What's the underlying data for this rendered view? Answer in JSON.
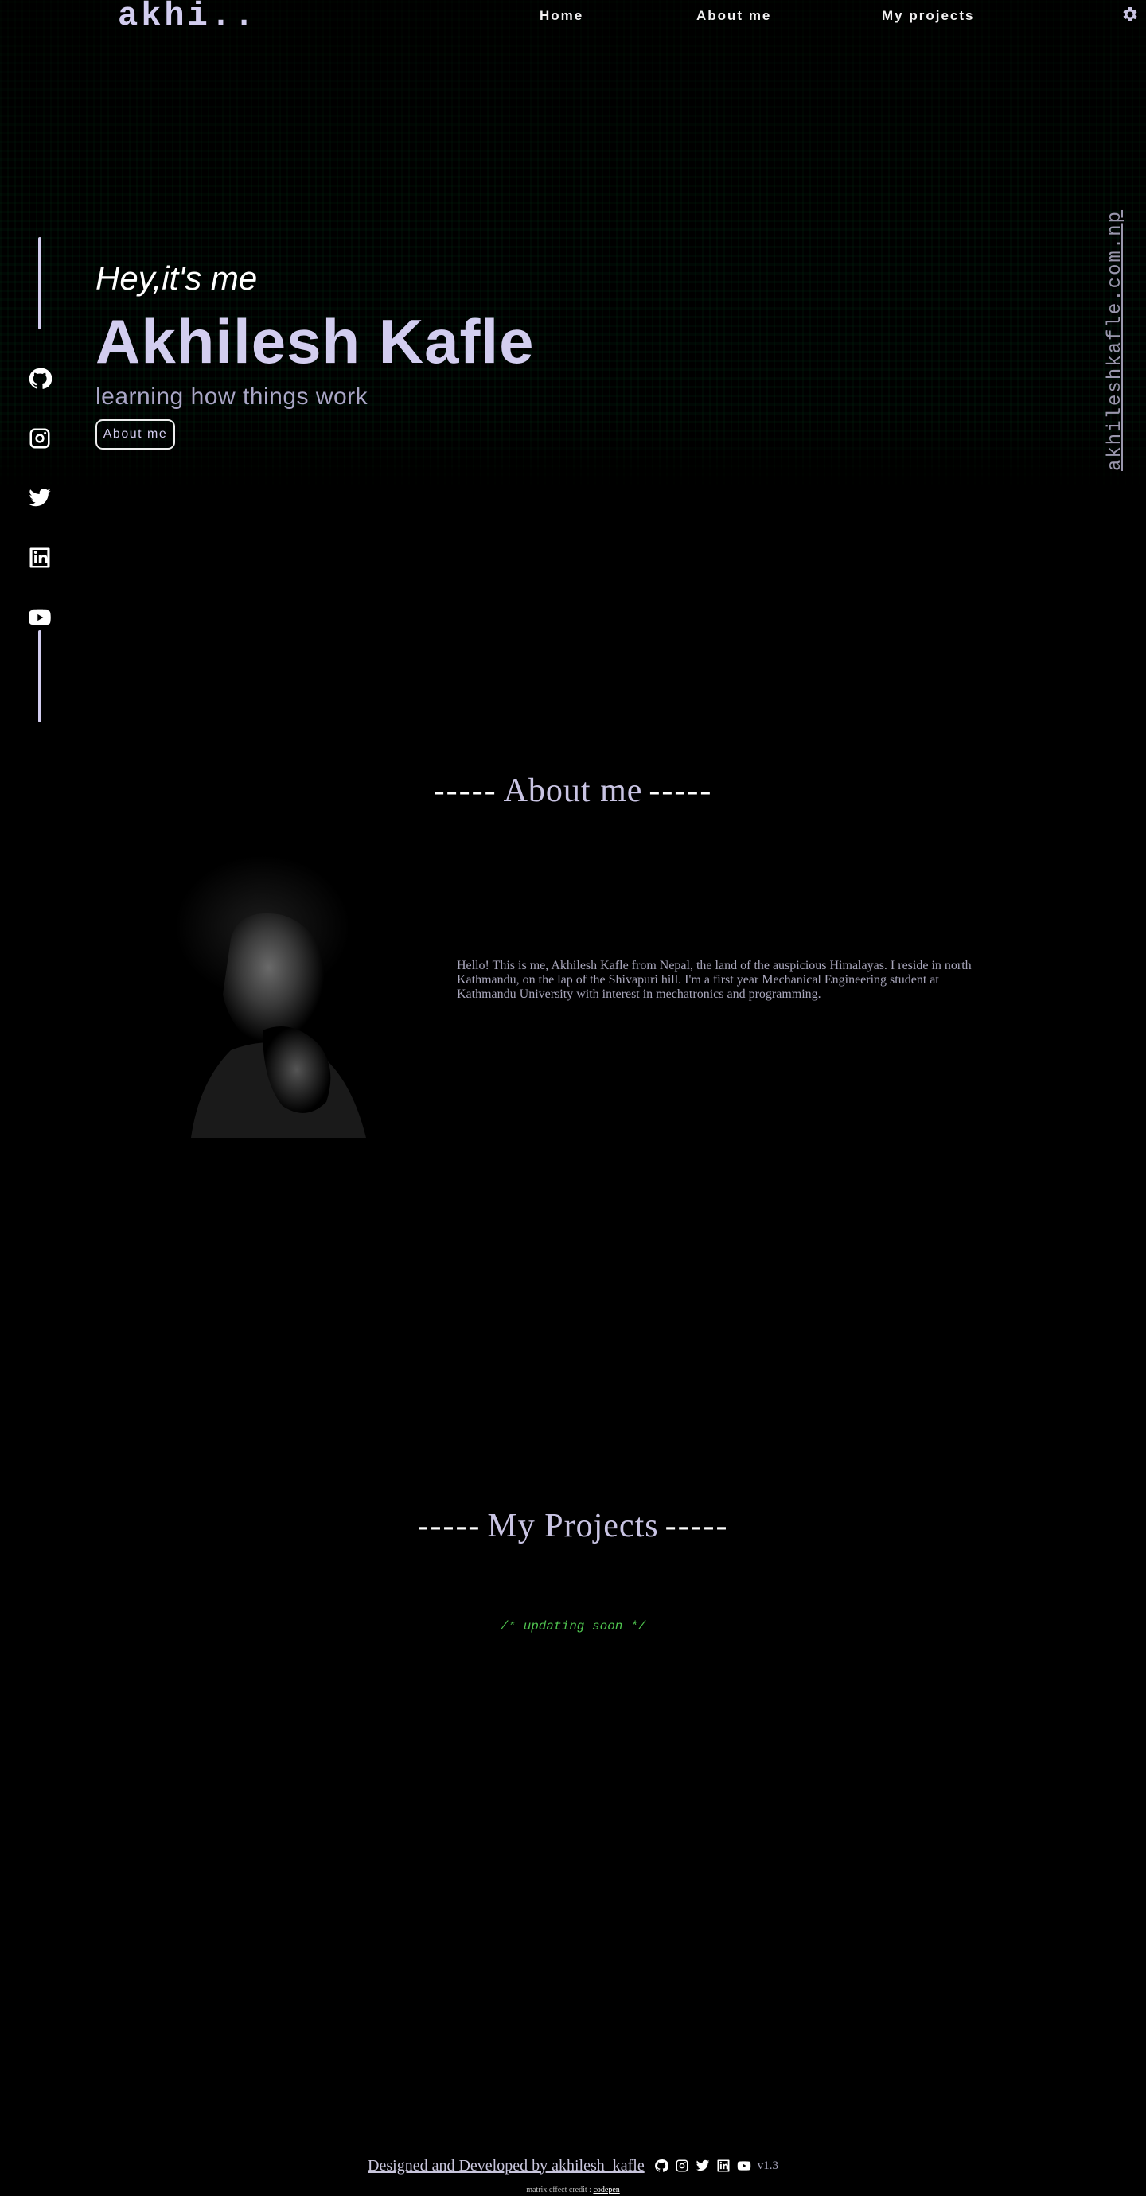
{
  "nav": {
    "logo": "akhi..",
    "links": [
      "Home",
      "About me",
      "My projects"
    ],
    "settings_icon": "gear-icon"
  },
  "social": [
    "github-icon",
    "instagram-icon",
    "twitter-icon",
    "linkedin-icon",
    "youtube-icon"
  ],
  "hero": {
    "greeting": "Hey,it's me",
    "name": "Akhilesh Kafle",
    "tagline": "learning how things work",
    "button": "About me",
    "domain": "akhileshkafle.com.np"
  },
  "about": {
    "heading": "About me",
    "dashes": "-----",
    "text": "Hello! This is me, Akhilesh Kafle from Nepal, the land of the auspicious Himalayas. I reside in north Kathmandu, on the lap of the Shivapuri hill. I'm a first year Mechanical Engineering student at Kathmandu University with interest in mechatronics and programming."
  },
  "projects": {
    "heading": "My Projects",
    "dashes": "-----",
    "status": "/* updating soon */"
  },
  "footer": {
    "credit": "Designed and Developed by akhilesh_kafle",
    "version": "v1.3",
    "matrix_credit_label": "matrix effect credit : ",
    "matrix_credit_link": "codepen"
  },
  "colors": {
    "accent": "#d2cdef",
    "background": "#000000",
    "status_green": "#4fc44f"
  }
}
